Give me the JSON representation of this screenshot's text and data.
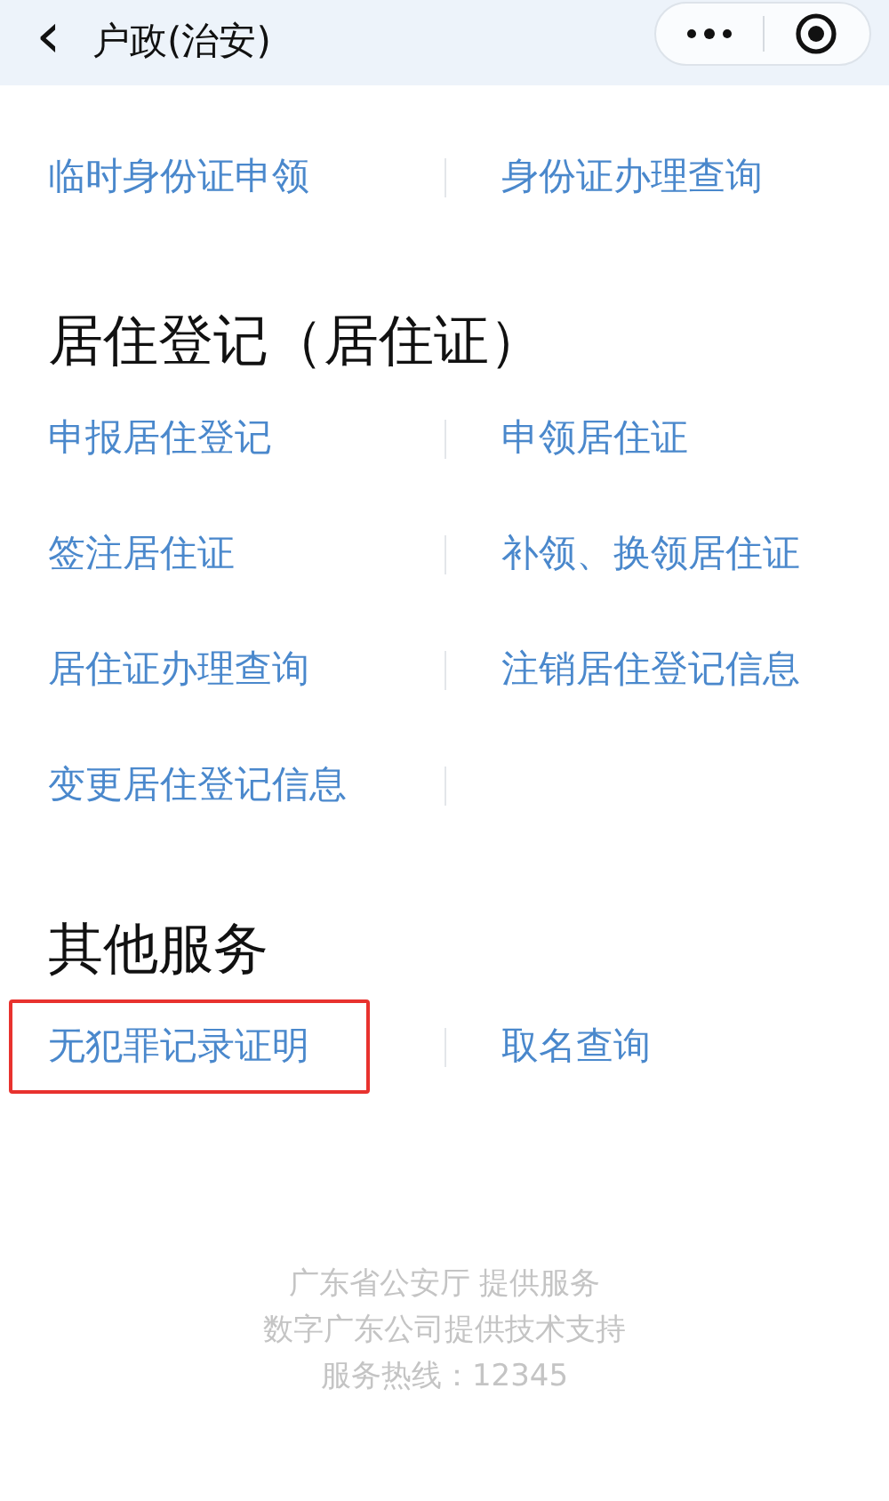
{
  "header": {
    "back": "‹",
    "title": "户政(治安)"
  },
  "sections": [
    {
      "items": [
        {
          "label": "临时身份证申领",
          "highlighted": false
        },
        {
          "label": "身份证办理查询",
          "highlighted": false
        }
      ]
    },
    {
      "title": "居住登记（居住证）",
      "items": [
        {
          "label": "申报居住登记",
          "highlighted": false
        },
        {
          "label": "申领居住证",
          "highlighted": false
        },
        {
          "label": "签注居住证",
          "highlighted": false
        },
        {
          "label": "补领、换领居住证",
          "highlighted": false
        },
        {
          "label": "居住证办理查询",
          "highlighted": false
        },
        {
          "label": "注销居住登记信息",
          "highlighted": false
        },
        {
          "label": "变更居住登记信息",
          "highlighted": false
        }
      ]
    },
    {
      "title": "其他服务",
      "items": [
        {
          "label": "无犯罪记录证明",
          "highlighted": true
        },
        {
          "label": "取名查询",
          "highlighted": false
        }
      ]
    }
  ],
  "footer": [
    "广东省公安厅 提供服务",
    "数字广东公司提供技术支持",
    "服务热线：12345"
  ]
}
